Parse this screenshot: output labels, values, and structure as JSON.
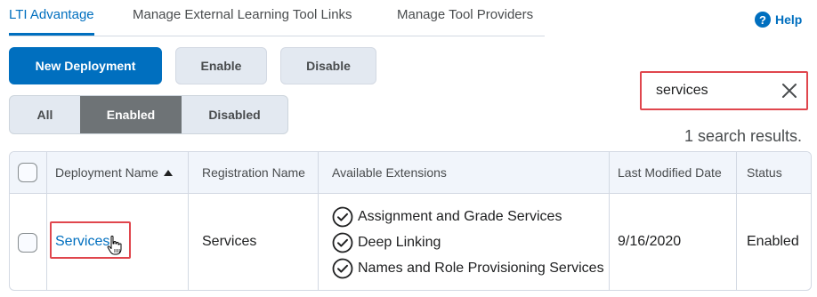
{
  "tabs": [
    {
      "label": "LTI Advantage",
      "active": true
    },
    {
      "label": "Manage External Learning Tool Links",
      "active": false
    },
    {
      "label": "Manage Tool Providers",
      "active": false
    }
  ],
  "help": {
    "icon_glyph": "?",
    "label": "Help"
  },
  "actions": {
    "new_deployment": "New Deployment",
    "enable": "Enable",
    "disable": "Disable"
  },
  "filter": {
    "options": [
      "All",
      "Enabled",
      "Disabled"
    ],
    "selected": "Enabled"
  },
  "search": {
    "value": "services",
    "placeholder": ""
  },
  "results_text": "1 search results.",
  "table": {
    "headers": [
      "Deployment Name",
      "Registration Name",
      "Available Extensions",
      "Last Modified Date",
      "Status"
    ],
    "sort_column": "Deployment Name",
    "sort_direction": "ascending",
    "rows": [
      {
        "deployment_name": "Services",
        "registration_name": "Services",
        "extensions": [
          "Assignment and Grade Services",
          "Deep Linking",
          "Names and Role Provisioning Services"
        ],
        "last_modified": "9/16/2020",
        "status": "Enabled"
      }
    ]
  },
  "colors": {
    "accent": "#006fbf",
    "highlight_border": "#e0464d",
    "selected_segment": "#6e7376",
    "header_bg": "#f1f5fb"
  },
  "icons": [
    "help-icon",
    "clear-icon",
    "sort-ascending-icon",
    "check-circle-icon",
    "hand-pointer-cursor-icon"
  ]
}
